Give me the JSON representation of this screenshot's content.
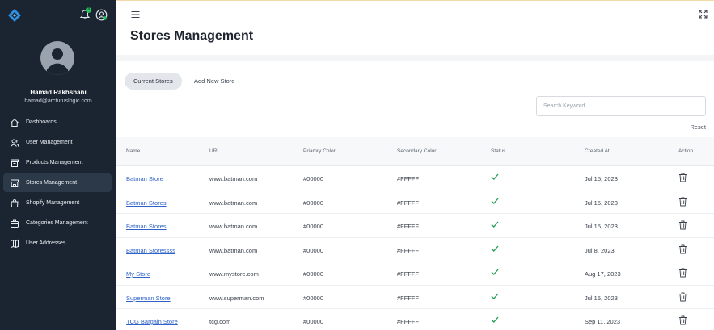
{
  "sidebar": {
    "notification_count": "3",
    "user": {
      "name": "Hamad Rakhshani",
      "email": "hamad@arcturuslogic.com"
    },
    "items": [
      {
        "label": "Dashboards",
        "icon": "home-icon"
      },
      {
        "label": "User Management",
        "icon": "users-icon"
      },
      {
        "label": "Products Management",
        "icon": "box-icon"
      },
      {
        "label": "Stores Management",
        "icon": "store-icon",
        "active": true
      },
      {
        "label": "Shopify Management",
        "icon": "bag-icon"
      },
      {
        "label": "Categories Management",
        "icon": "briefcase-icon"
      },
      {
        "label": "User Addresses",
        "icon": "map-icon"
      }
    ]
  },
  "header": {
    "title": "Stores Management"
  },
  "tabs": {
    "current": "Current Stores",
    "add": "Add New Store"
  },
  "search": {
    "placeholder": "Search Keyword"
  },
  "reset_label": "Reset",
  "table": {
    "columns": [
      "Name",
      "URL",
      "Priamry Color",
      "Secondary Color",
      "Status",
      "Created At",
      "Action"
    ],
    "rows": [
      {
        "name": "Batman Store",
        "url": "www.batman.com",
        "primary": "#00000",
        "secondary": "#FFFFF",
        "created": "Jul 15, 2023"
      },
      {
        "name": "Batman Stores",
        "url": "www.batman.com",
        "primary": "#00000",
        "secondary": "#FFFFF",
        "created": "Jul 15, 2023"
      },
      {
        "name": "Batman Stores",
        "url": "www.batman.com",
        "primary": "#00000",
        "secondary": "#FFFFF",
        "created": "Jul 15, 2023"
      },
      {
        "name": "Batman Storessss",
        "url": "www.batman.com",
        "primary": "#00000",
        "secondary": "#FFFFF",
        "created": "Jul 8, 2023"
      },
      {
        "name": "My Store",
        "url": "www.mystore.com",
        "primary": "#00000",
        "secondary": "#FFFFF",
        "created": "Aug 17, 2023"
      },
      {
        "name": "Superman Store",
        "url": "www.superman.com",
        "primary": "#00000",
        "secondary": "#FFFFF",
        "created": "Jul 15, 2023"
      },
      {
        "name": "TCG Bargain Store",
        "url": "tcg.com",
        "primary": "#00000",
        "secondary": "#FFFFF",
        "created": "Sep 11, 2023"
      }
    ]
  },
  "colors": {
    "sidebar_bg": "#1b2531",
    "accent": "#2e62c9",
    "status_ok": "#1f9d55"
  }
}
